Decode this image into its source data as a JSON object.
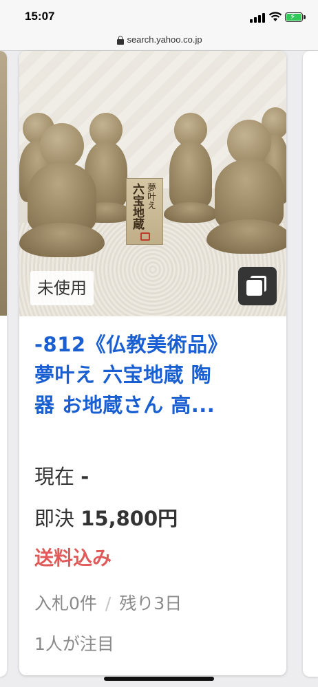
{
  "status_bar": {
    "time": "15:07"
  },
  "browser": {
    "url": "search.yahoo.co.jp"
  },
  "listing": {
    "badge": "未使用",
    "plaque_text_1": "夢叶え",
    "plaque_text_2": "六宝地蔵",
    "title_line_1": "-812《仏教美術品》",
    "title_line_2": "夢叶え 六宝地蔵 陶",
    "title_line_3": "器 お地蔵さん 高...",
    "current_label": "現在",
    "current_value": "-",
    "buynow_label": "即決",
    "buynow_value": "15,800円",
    "shipping": "送料込み",
    "bids": "入札0件",
    "meta_separator": "/",
    "remaining": "残り3日",
    "watchers": "1人が注目"
  },
  "colors": {
    "title": "#1a5fd1",
    "shipping": "#e05a5a",
    "meta": "#8a8a8a"
  }
}
